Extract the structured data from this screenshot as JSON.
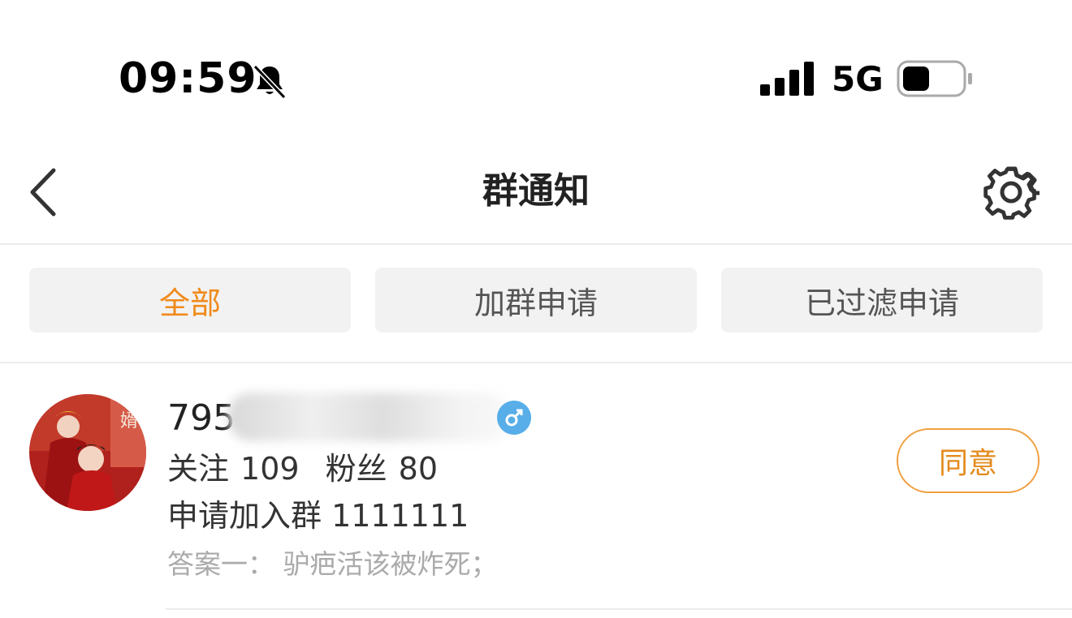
{
  "status_bar": {
    "time": "09:59",
    "network": "5G",
    "icons": [
      "bell-muted-icon",
      "signal-icon",
      "battery-icon"
    ]
  },
  "nav": {
    "title": "群通知",
    "icons": [
      "back-icon",
      "gear-icon"
    ]
  },
  "tabs": [
    {
      "label": "全部",
      "active": true
    },
    {
      "label": "加群申请",
      "active": false
    },
    {
      "label": "已过滤申请",
      "active": false
    }
  ],
  "request": {
    "username": "795",
    "follow_label": "关注",
    "follow_count": "109",
    "fans_label": "粉丝",
    "fans_count": "80",
    "apply_text": "申请加入群 1111111",
    "answer_text": "答案一：  驴疤活该被炸死；",
    "agree_label": "同意",
    "gender_icon": "male-icon"
  },
  "colors": {
    "accent": "#f08a1a",
    "tab_bg": "#f2f2f2",
    "gender_badge": "#58aee8"
  }
}
